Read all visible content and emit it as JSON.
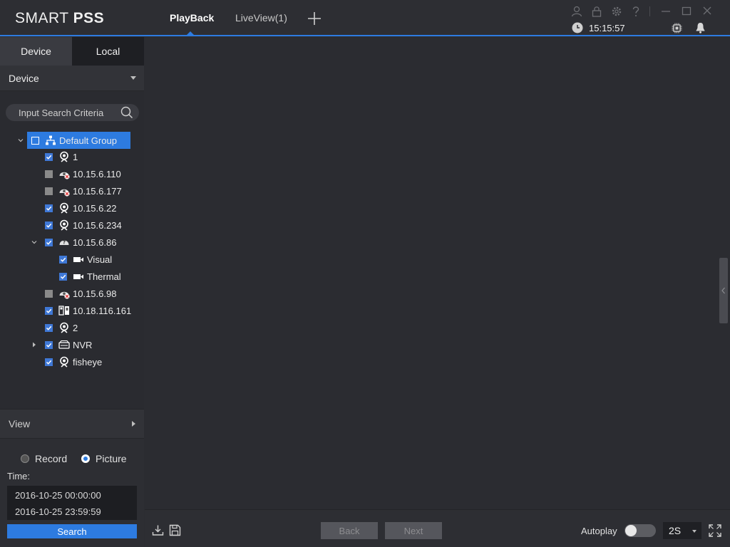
{
  "app": {
    "logo_light": "SMART ",
    "logo_bold": "PSS",
    "tabs": [
      {
        "label": "PlayBack",
        "active": true
      },
      {
        "label": "LiveView(1)",
        "active": false
      }
    ],
    "clock": "15:15:57",
    "accent_color": "#2d7be0"
  },
  "sidebar": {
    "tabs": [
      {
        "label": "Device",
        "active": true
      },
      {
        "label": "Local",
        "active": false
      }
    ],
    "device_header": "Device",
    "search": {
      "placeholder": "Input Search Criteria"
    },
    "tree": {
      "group": {
        "label": "Default Group",
        "checked": false,
        "expanded": true
      },
      "items": [
        {
          "label": "1",
          "checked": true,
          "icon": "camera-icon"
        },
        {
          "label": "10.15.6.110",
          "checked": false,
          "icon": "offline-camera-icon"
        },
        {
          "label": "10.15.6.177",
          "checked": false,
          "icon": "offline-camera-icon"
        },
        {
          "label": "10.15.6.22",
          "checked": true,
          "icon": "camera-icon"
        },
        {
          "label": "10.15.6.234",
          "checked": true,
          "icon": "camera-icon"
        },
        {
          "label": "10.15.6.86",
          "checked": true,
          "icon": "unknown-device-icon",
          "expanded": true,
          "children": [
            {
              "label": "Visual",
              "checked": true,
              "icon": "video-channel-icon"
            },
            {
              "label": "Thermal",
              "checked": true,
              "icon": "video-channel-icon"
            }
          ]
        },
        {
          "label": "10.15.6.98",
          "checked": false,
          "icon": "offline-camera-icon"
        },
        {
          "label": "10.18.116.161",
          "checked": true,
          "icon": "door-station-icon"
        },
        {
          "label": "2",
          "checked": true,
          "icon": "camera-icon"
        },
        {
          "label": "NVR",
          "checked": true,
          "icon": "nvr-icon",
          "expanded": false
        },
        {
          "label": "fisheye",
          "checked": true,
          "icon": "camera-icon"
        }
      ]
    },
    "view_section": "View",
    "record_type": {
      "options": [
        "Record",
        "Picture"
      ],
      "selected": "Picture"
    },
    "time_label": "Time:",
    "time_start": "2016-10-25 00:00:00",
    "time_end": "2016-10-25 23:59:59",
    "search_button": "Search"
  },
  "footer": {
    "back_label": "Back",
    "next_label": "Next",
    "autoplay_label": "Autoplay",
    "autoplay_on": false,
    "interval": "2S"
  }
}
